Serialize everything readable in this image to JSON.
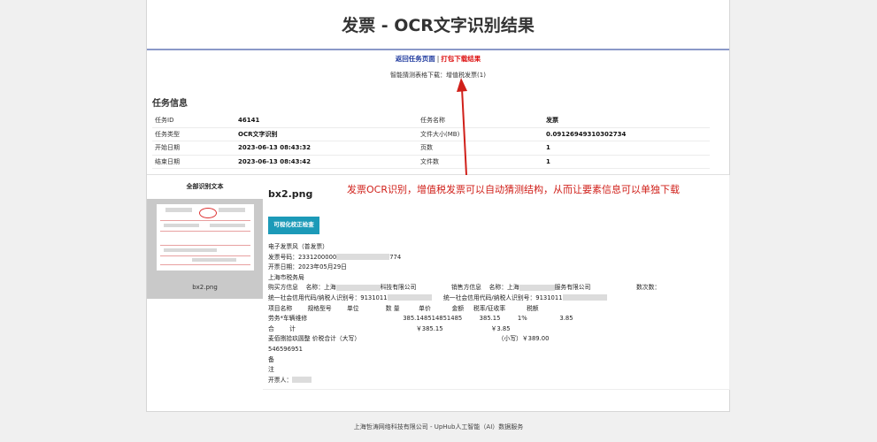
{
  "header": {
    "title": "发票 - OCR文字识别结果",
    "back_link": "返回任务页面",
    "separator": "|",
    "download_link": "打包下载结果"
  },
  "guess": {
    "label": "智能猜测表格下载：",
    "link": "增值税发票(1)"
  },
  "task": {
    "section_title": "任务信息",
    "rows": [
      {
        "k1": "任务ID",
        "v1": "46141",
        "k2": "任务名称",
        "v2": "发票"
      },
      {
        "k1": "任务类型",
        "v1": "OCR文字识别",
        "k2": "文件大小(MB)",
        "v2": "0.09126949310302734"
      },
      {
        "k1": "开始日期",
        "v1": "2023-06-13 08:43:32",
        "k2": "页数",
        "v2": "1"
      },
      {
        "k1": "结束日期",
        "v1": "2023-06-13 08:43:42",
        "k2": "文件数",
        "v2": "1"
      }
    ]
  },
  "left_panel": {
    "heading": "全部识别文本",
    "thumb_name": "bx2.png"
  },
  "result": {
    "filename": "bx2.png",
    "visual_button": "可视化校正检查",
    "lines": [
      "电子发票风（普发票）",
      "发票号码：2331200000",
      "开票日期：2023年05月29日",
      "上海市税务局",
      "购买方信息    名称：上海",
      "统一社会信用代码/纳税人识别号：9131011",
      "项目名称        规格型号        单位              数 量          单价           金额     税率/征收率           税额",
      "劳务*车辆维修                                                  385.148514851485         385.15         1%                 3.85",
      "合        计                                                               ￥385.15                         ￥3.85",
      "麦佰捌拾玖圆整 价税合计（大写）                                                                        （小写）￥389.00",
      "546596951",
      "备",
      "注",
      "开票人："
    ],
    "line5_mid": "科技有限公司",
    "line5_right_label": "销售方信息    名称：上海",
    "line5_right_end": "服务有限公司",
    "line5_far": "数次数：",
    "line6_right": "统一社会信用代码/纳税人识别号：9131011",
    "line2_tail": "774"
  },
  "annotation": {
    "text": "发票OCR识别，增值税发票可以自动猜测结构，从而让要素信息可以单独下载",
    "color": "#d0201a"
  },
  "footer": {
    "text": "上海哲涛网络科技有限公司 - UpHub人工智能（AI）数据服务"
  }
}
